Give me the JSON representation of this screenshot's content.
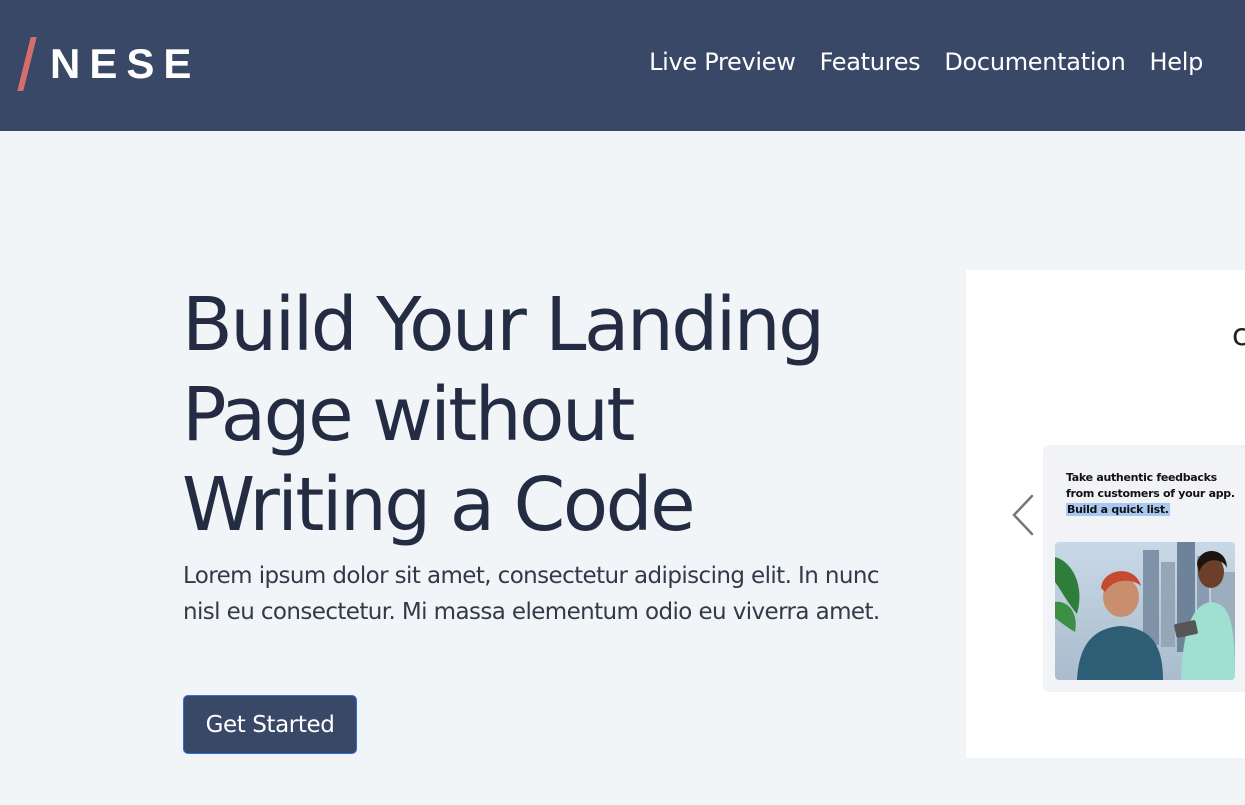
{
  "brand": {
    "name": "NESE",
    "accent": "#d56d6e",
    "nav_bg": "#3a4867"
  },
  "nav": {
    "links": [
      "Live Preview",
      "Features",
      "Documentation",
      "Help"
    ]
  },
  "hero": {
    "title_lines": [
      "Build Your Landing",
      "Page without",
      "Writing a Code"
    ],
    "description": "Lorem ipsum dolor sit amet, consectetur adipiscing elit. In nunc nisl eu consectetur. Mi massa elementum odio eu viverra amet.",
    "cta_label": "Get Started"
  },
  "preview": {
    "card_text": "Take authentic feedbacks from customers of your app.",
    "card_highlight": "Build a quick list.",
    "prev_icon": "chevron-left-icon",
    "photo_icon": "people-photo"
  }
}
